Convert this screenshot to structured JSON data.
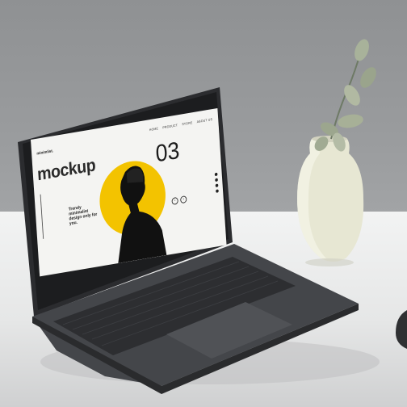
{
  "screen": {
    "brand": "minimlist.",
    "nav": [
      "HOME",
      "PRODUCT",
      "STORE",
      "ABOUT US"
    ],
    "headline": "mockup",
    "number": "03",
    "tagline": "Trendy minimalist design only for you.",
    "arrow_prev": "‹",
    "arrow_next": "›"
  },
  "colors": {
    "wall": "#8f9193",
    "table": "#eeeeee",
    "accent_yellow": "#f3c300",
    "laptop_body": "#3a3b3e",
    "vase": "#e6e6d2"
  },
  "icons": [
    "laptop",
    "vase",
    "eucalyptus-branch",
    "person-portrait"
  ]
}
